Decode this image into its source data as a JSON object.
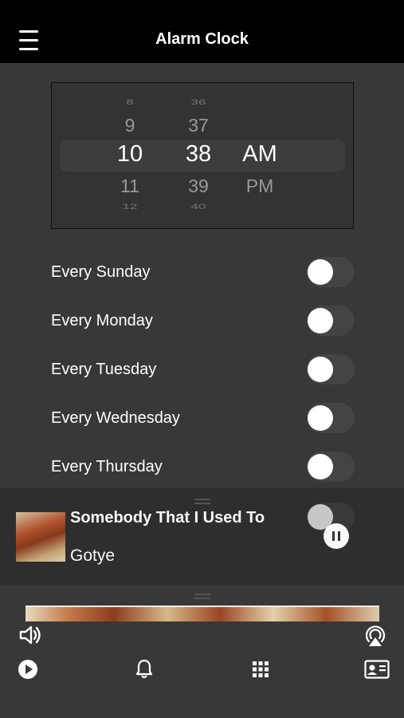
{
  "header": {
    "title": "Alarm Clock"
  },
  "time_picker": {
    "hours": [
      "8",
      "9",
      "10",
      "11",
      "12"
    ],
    "minutes": [
      "36",
      "37",
      "38",
      "39",
      "40"
    ],
    "periods": [
      "",
      "",
      "AM",
      "PM",
      ""
    ]
  },
  "days": [
    {
      "label": "Every Sunday",
      "enabled": false
    },
    {
      "label": "Every Monday",
      "enabled": false
    },
    {
      "label": "Every Tuesday",
      "enabled": false
    },
    {
      "label": "Every Wednesday",
      "enabled": false
    },
    {
      "label": "Every Thursday",
      "enabled": false
    }
  ],
  "now_playing": {
    "title": "Somebody That I Used To",
    "artist": "Gotye",
    "state": "playing"
  },
  "icons": {
    "menu": "hamburger-menu-icon",
    "pause": "pause-icon",
    "volume": "speaker-volume-icon",
    "airplay": "airplay-icon",
    "play": "play-icon",
    "alarm": "bell-icon",
    "grid": "grid-icon",
    "contact": "contact-card-icon"
  }
}
